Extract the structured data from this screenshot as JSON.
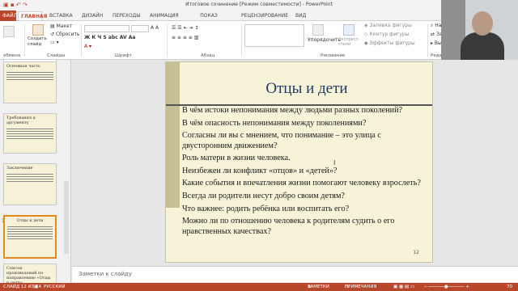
{
  "window": {
    "title": "Итоговое сочинение [Режим совместимости] - PowerPoint"
  },
  "tabs": [
    {
      "label": "ФАЙЛ"
    },
    {
      "label": "ГЛАВНАЯ"
    },
    {
      "label": "ВСТАВКА"
    },
    {
      "label": "ДИЗАЙН"
    },
    {
      "label": "ПЕРЕХОДЫ"
    },
    {
      "label": "АНИМАЦИЯ"
    },
    {
      "label": "ПОКАЗ СЛАЙДОВ"
    },
    {
      "label": "РЕЦЕНЗИРОВАНИЕ"
    },
    {
      "label": "ВИД"
    }
  ],
  "ribbon": {
    "clipboard_label": "обмена",
    "create_slide_label": "Создать слайд",
    "layout_label": "Макет",
    "reset_label": "Сбросить",
    "slides_group_label": "Слайды",
    "font_group_label": "Шрифт",
    "paragraph_group_label": "Абзац",
    "arrange_label": "Упорядочить",
    "express_styles_label": "Экспресс-стили",
    "shape_fill_label": "Заливка фигуры",
    "shape_outline_label": "Контур фигуры",
    "shape_effects_label": "Эффекты фигуры",
    "drawing_group_label": "Рисование",
    "find_label": "Найти",
    "replace_label": "Заменить",
    "select_label": "Выделить",
    "editing_group_label": "Редактирование"
  },
  "thumbnails": [
    {
      "title": "Основная часть"
    },
    {
      "title": "Требования к аргументу"
    },
    {
      "title": "Заключение"
    },
    {
      "title": "Отцы и дети"
    },
    {
      "title": "Список произведений по направлению «Отцы и дети»"
    }
  ],
  "slide": {
    "title": "Отцы и дети",
    "bullets": [
      "В чём истоки непонимания между людьми разных поколений?",
      "В чём опасность непонимания между поколениями?",
      "Согласны ли вы с мнением, что понимание – это улица с двусторонним движением?",
      "Роль матери в жизни человека.",
      "Неизбежен ли конфликт «отцов» и «детей»?",
      "Какие события и впечатления жизни помогают человеку взрослеть?",
      "Всегда ли родители несут добро своим детям?",
      "Что важнее: родить ребёнка или воспитать его?",
      "Можно ли по отношению человека к родителям судить о его нравственных качествах?"
    ],
    "page_number": "12"
  },
  "notes": {
    "placeholder": "Заметки к слайду"
  },
  "status": {
    "slide_info": "СЛАЙД 12 ИЗ 14",
    "language": "РУССКИЙ",
    "notes": "ЗАМЕТКИ",
    "comments": "ПРИМЕЧАНИЯ",
    "zoom": "70"
  },
  "colors": {
    "accent": "#b7472a",
    "slide_bg": "#f7f3d8",
    "slide_sidebar": "#c5bf93",
    "title_color": "#1f3864"
  }
}
